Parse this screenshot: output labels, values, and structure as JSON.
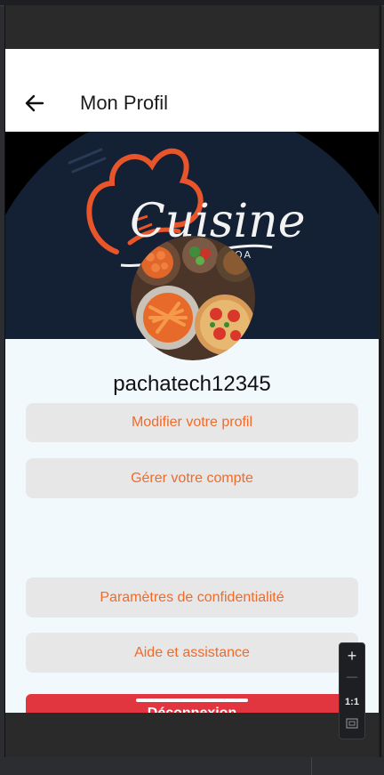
{
  "appbar": {
    "title": "Mon Profil",
    "back_icon": "arrow-back-icon"
  },
  "banner": {
    "logo_text": "Cuisine",
    "logo_suffix": "OA",
    "colors": {
      "circle": "#142033",
      "accent": "#e8552a"
    }
  },
  "profile": {
    "username": "pachatech12345"
  },
  "menu": {
    "edit_profile": "Modifier votre profil",
    "manage_account": "Gérer votre compte",
    "privacy": "Paramètres de confidentialité",
    "help": "Aide et assistance",
    "logout": "Déconnexion"
  },
  "zoom_controls": {
    "zoom_in": "+",
    "zoom_out": "—",
    "reset": "1:1"
  },
  "colors": {
    "button_text": "#f06a2a",
    "button_bg": "#e7e7e7",
    "logout_bg": "#e1353f",
    "content_bg": "#f1f9fd"
  }
}
